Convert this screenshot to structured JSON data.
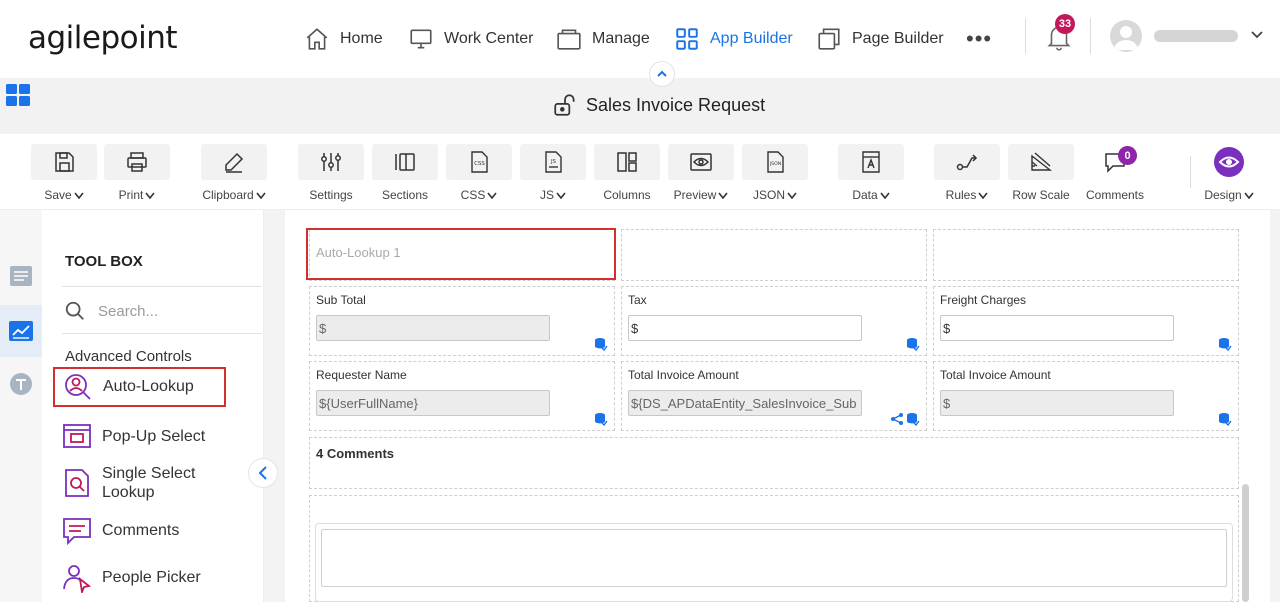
{
  "app": {
    "logo": "agilepoint",
    "nav": [
      {
        "label": "Home",
        "icon": "home-icon"
      },
      {
        "label": "Work Center",
        "icon": "monitor-icon"
      },
      {
        "label": "Manage",
        "icon": "folder-icon"
      },
      {
        "label": "App Builder",
        "icon": "grid-icon",
        "active": true
      },
      {
        "label": "Page Builder",
        "icon": "pages-icon"
      }
    ],
    "more": "•••",
    "notifications_count": "33"
  },
  "form": {
    "title": "Sales Invoice Request"
  },
  "ribbon": [
    {
      "label": "Save",
      "icon": "save-icon",
      "dropdown": true
    },
    {
      "label": "Print",
      "icon": "print-icon",
      "dropdown": true
    },
    {
      "label": "Clipboard",
      "icon": "clipboard-icon",
      "dropdown": true
    },
    {
      "label": "Settings",
      "icon": "settings-icon",
      "dropdown": false
    },
    {
      "label": "Sections",
      "icon": "sections-icon",
      "dropdown": false
    },
    {
      "label": "CSS",
      "icon": "css-icon",
      "dropdown": true
    },
    {
      "label": "JS",
      "icon": "js-icon",
      "dropdown": true
    },
    {
      "label": "Columns",
      "icon": "columns-icon",
      "dropdown": false
    },
    {
      "label": "Preview",
      "icon": "preview-icon",
      "dropdown": true
    },
    {
      "label": "JSON",
      "icon": "json-icon",
      "dropdown": true
    },
    {
      "label": "Data",
      "icon": "data-icon",
      "dropdown": true
    },
    {
      "label": "Rules",
      "icon": "rules-icon",
      "dropdown": true
    },
    {
      "label": "Row Scale",
      "icon": "row-scale-icon",
      "dropdown": false
    },
    {
      "label": "Comments",
      "icon": "comments-icon",
      "dropdown": false,
      "badge": "0"
    },
    {
      "label": "Design",
      "icon": "eye-icon",
      "dropdown": true
    }
  ],
  "toolbox": {
    "title": "TOOL BOX",
    "search_placeholder": "Search...",
    "section": "Advanced Controls",
    "items": [
      {
        "label": "Auto-Lookup",
        "icon": "auto-lookup-icon"
      },
      {
        "label": "Pop-Up Select",
        "icon": "popup-select-icon"
      },
      {
        "label": "Single Select Lookup",
        "icon": "single-select-lookup-icon"
      },
      {
        "label": "Comments",
        "icon": "comments-control-icon"
      },
      {
        "label": "People Picker",
        "icon": "people-picker-icon"
      }
    ]
  },
  "canvas": {
    "auto_lookup_placeholder": "Auto-Lookup 1",
    "row1": [
      {
        "label": "Sub Total",
        "value": "$",
        "disabled": true
      },
      {
        "label": "Tax",
        "value": "$",
        "disabled": false
      },
      {
        "label": "Freight Charges",
        "value": "$",
        "disabled": false
      }
    ],
    "row2": [
      {
        "label": "Requester Name",
        "value": "${UserFullName}",
        "disabled": true
      },
      {
        "label": "Total Invoice Amount",
        "value": "${DS_APDataEntity_SalesInvoice_Sub",
        "disabled": true
      },
      {
        "label": "Total Invoice Amount",
        "value": "$",
        "disabled": true
      }
    ],
    "comments_header": "4 Comments"
  }
}
